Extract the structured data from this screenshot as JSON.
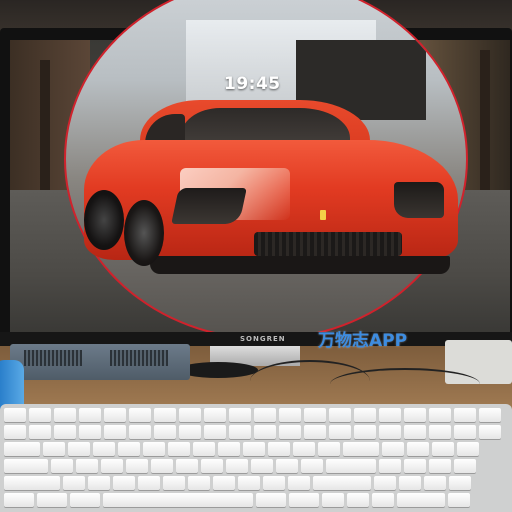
{
  "photo": {
    "subject": "Monitor displaying a red sports car wallpaper with a red circle drawn around it",
    "screen_clock": "19:45",
    "monitor_brand": "SONGREN",
    "watermark": "万物志APP",
    "highlight_color": "#d0222c",
    "car_color": "#e23b22"
  }
}
